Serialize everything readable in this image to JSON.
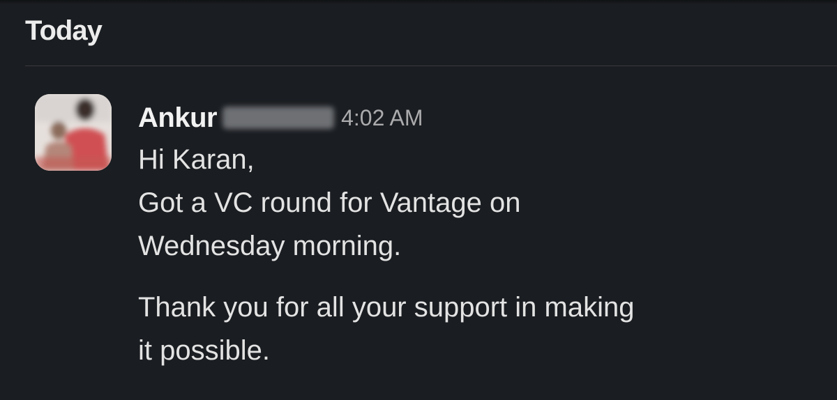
{
  "day_divider": {
    "label": "Today"
  },
  "message": {
    "sender_first_name": "Ankur",
    "sender_last_name_redacted": true,
    "timestamp": "4:02 AM",
    "paragraph1": [
      "Hi Karan,",
      "Got a VC round for Vantage on",
      "Wednesday morning."
    ],
    "paragraph2": [
      "Thank you for all your support in making",
      "it possible."
    ]
  },
  "colors": {
    "background": "#1a1d21",
    "text_primary": "#e3e3e3",
    "timestamp": "#ababad",
    "divider": "#383a3f"
  }
}
